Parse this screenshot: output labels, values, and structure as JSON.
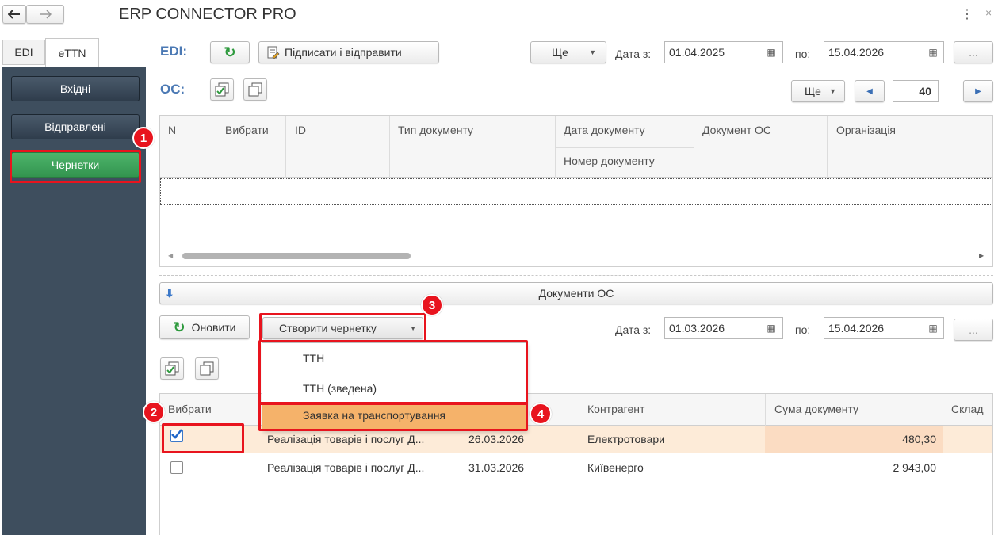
{
  "window": {
    "title": "ERP CONNECTOR PRO",
    "back_icon": "arrow-left-icon",
    "forward_icon": "arrow-right-icon",
    "menu_icon": "kebab-menu-icon",
    "close_icon": "close-icon"
  },
  "tabs": [
    {
      "label": "EDI"
    },
    {
      "label": "eTTN"
    }
  ],
  "sidebar": {
    "items": [
      {
        "label": "Вхідні"
      },
      {
        "label": "Відправлені"
      },
      {
        "label": "Чернетки"
      }
    ]
  },
  "edi_bar": {
    "label": "EDI:",
    "sign_send_label": "Підписати і відправити",
    "more_label": "Ще",
    "date_from_label": "Дата з:",
    "date_from": "01.04.2025",
    "date_to_label": "по:",
    "date_to": "15.04.2026",
    "dots_label": "..."
  },
  "oc_bar": {
    "label": "ОС:",
    "more_label": "Ще",
    "page_value": "40"
  },
  "top_table": {
    "columns": [
      "N",
      "Вибрати",
      "ID",
      "Тип документу",
      "Дата документу",
      "Номер документу",
      "Документ ОС",
      "Організація"
    ]
  },
  "docs_oc": {
    "label": "Документи ОС"
  },
  "bottom_bar": {
    "refresh_label": "Оновити",
    "create_draft_label": "Створити чернетку",
    "date_from_label": "Дата з:",
    "date_from": "01.03.2026",
    "date_to_label": "по:",
    "date_to": "15.04.2026",
    "dots_label": "..."
  },
  "dropdown": {
    "items": [
      {
        "label": "ТТН"
      },
      {
        "label": "ТТН (зведена)"
      },
      {
        "label": "Заявка на транспортування"
      }
    ]
  },
  "bottom_table": {
    "columns": [
      "Вибрати",
      "Контрагент",
      "Сума документу",
      "Склад"
    ],
    "rows": [
      {
        "checked": true,
        "doc": "Реалізація товарів і послуг Д...",
        "date": "26.03.2026",
        "counterparty": "Електротовари",
        "sum": "480,30"
      },
      {
        "checked": false,
        "doc": "Реалізація товарів і послуг Д...",
        "date": "31.03.2026",
        "counterparty": "Київенерго",
        "sum": "2 943,00"
      }
    ]
  },
  "annotations": {
    "badges": [
      "1",
      "2",
      "3",
      "4"
    ],
    "highlight_color": "#e8141e"
  },
  "colors": {
    "accent_blue": "#4b79b4",
    "sidebar_bg": "#3e4e5e",
    "active_green": "#3fa35d",
    "selected_row": "#fdebd8",
    "menu_highlight": "#f5b26a"
  }
}
